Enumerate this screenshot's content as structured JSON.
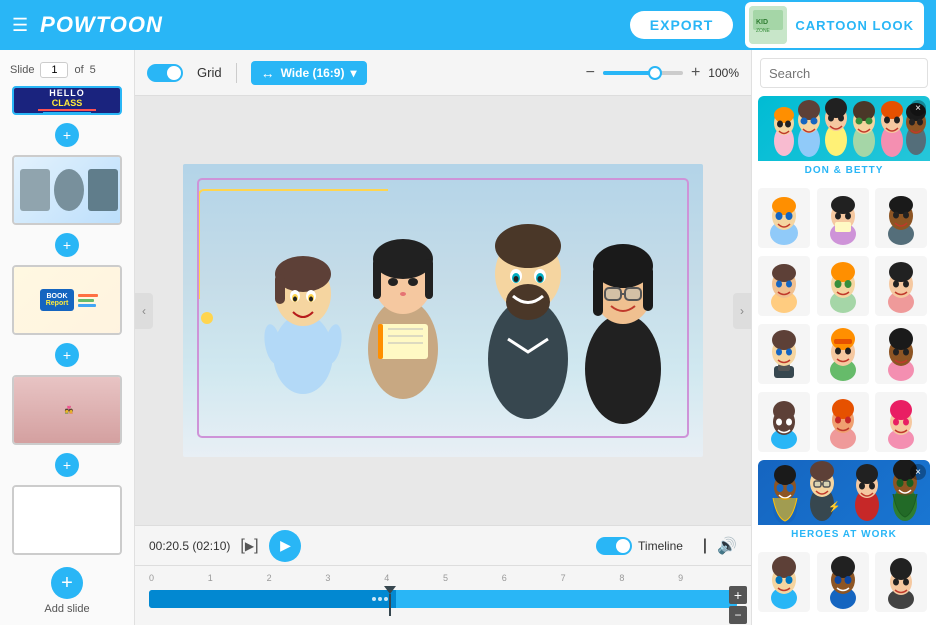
{
  "app": {
    "name": "POWTOON",
    "logo_accent": "OO"
  },
  "header": {
    "export_label": "EXPORT",
    "cartoon_look_label": "CARTOON LOOK"
  },
  "slide_nav": {
    "label": "Slide",
    "current": "1",
    "total": "5"
  },
  "toolbar": {
    "grid_label": "Grid",
    "aspect_ratio": "Wide (16:9)",
    "zoom_value": "100%"
  },
  "playback": {
    "timecode": "00:20.5 (02:10)",
    "timeline_label": "Timeline"
  },
  "timeline": {
    "marks": [
      "0",
      "1",
      "2",
      "3",
      "4",
      "5",
      "6",
      "7",
      "8",
      "9"
    ]
  },
  "right_panel": {
    "search_placeholder": "Search",
    "featured_1_label": "DON & BETTY",
    "featured_2_label": "HEROES AT WORK",
    "add_slide_label": "Add slide"
  },
  "slides": [
    {
      "id": 1,
      "type": "hello-class"
    },
    {
      "id": 2,
      "type": "photo"
    },
    {
      "id": 3,
      "type": "book-report"
    },
    {
      "id": 4,
      "type": "couple"
    },
    {
      "id": 5,
      "type": "blank"
    }
  ]
}
